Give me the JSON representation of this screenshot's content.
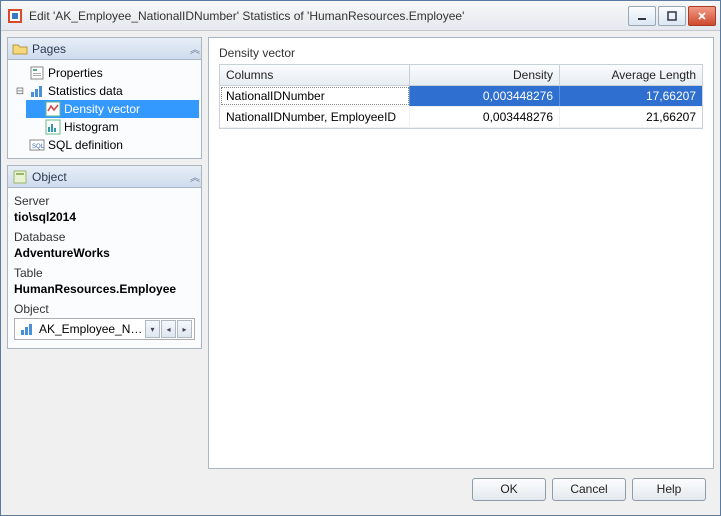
{
  "window": {
    "title": "Edit 'AK_Employee_NationalIDNumber' Statistics of 'HumanResources.Employee'"
  },
  "pages_panel": {
    "title": "Pages",
    "items": {
      "properties": "Properties",
      "statistics_data": "Statistics data",
      "density_vector": "Density vector",
      "histogram": "Histogram",
      "sql_definition": "SQL definition"
    }
  },
  "object_panel": {
    "title": "Object",
    "server_label": "Server",
    "server_value": "tio\\sql2014",
    "database_label": "Database",
    "database_value": "AdventureWorks",
    "table_label": "Table",
    "table_value": "HumanResources.Employee",
    "object_label": "Object",
    "combo_value": "AK_Employee_Natio..."
  },
  "main": {
    "section_label": "Density vector",
    "headers": {
      "columns": "Columns",
      "density": "Density",
      "avg_length": "Average Length"
    },
    "rows": [
      {
        "columns": "NationalIDNumber",
        "density": "0,003448276",
        "avg_length": "17,66207"
      },
      {
        "columns": "NationalIDNumber, EmployeeID",
        "density": "0,003448276",
        "avg_length": "21,66207"
      }
    ]
  },
  "buttons": {
    "ok": "OK",
    "cancel": "Cancel",
    "help": "Help"
  }
}
